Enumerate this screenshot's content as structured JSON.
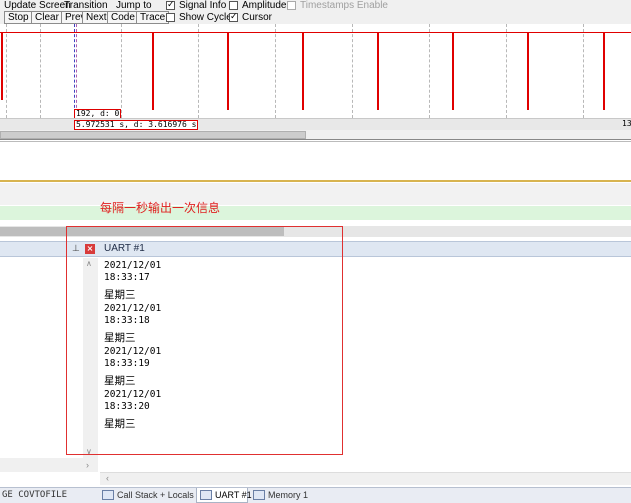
{
  "toolbar": {
    "update_screen_label": "Update Screen",
    "transition_label": "Transition",
    "jump_to_label": "Jump to",
    "stop_label": "Stop",
    "clear_label": "Clear",
    "prev_label": "Prev",
    "next_label": "Next",
    "code_label": "Code",
    "trace_label": "Trace",
    "signal_info_label": "Signal Info",
    "signal_info_checked": true,
    "amplitude_label": "Amplitude",
    "amplitude_checked": false,
    "timestamps_enable_label": "Timestamps Enable",
    "timestamps_enable_checked": false,
    "show_cycles_label": "Show Cycles",
    "show_cycles_checked": false,
    "cursor_label": "Cursor",
    "cursor_checked": true
  },
  "logic_analyzer": {
    "signal_color": "#e00000",
    "value_readout": "192,  d: 0",
    "time_readout": "5.972531 s,  d: 3.616976 s",
    "right_time_label": "13"
  },
  "annotation": {
    "text": "每隔一秒输出一次信息",
    "color": "#e02020"
  },
  "uart_panel": {
    "title": "UART #1",
    "lines": [
      {
        "text": "2021/12/01",
        "cn": false
      },
      {
        "text": "18:33:17",
        "cn": false
      },
      {
        "text": "星期三",
        "cn": true
      },
      {
        "text": "2021/12/01",
        "cn": false
      },
      {
        "text": "18:33:18",
        "cn": false
      },
      {
        "text": "星期三",
        "cn": true
      },
      {
        "text": "2021/12/01",
        "cn": false
      },
      {
        "text": "18:33:19",
        "cn": false
      },
      {
        "text": "星期三",
        "cn": true
      },
      {
        "text": "2021/12/01",
        "cn": false
      },
      {
        "text": "18:33:20",
        "cn": false
      },
      {
        "text": "星期三",
        "cn": true
      }
    ]
  },
  "bottom_bar": {
    "left_text": "GE COVTOFILE",
    "tabs": [
      {
        "label": "Call Stack + Locals",
        "active": false
      },
      {
        "label": "UART #1",
        "active": true
      },
      {
        "label": "Memory 1",
        "active": false
      }
    ]
  }
}
